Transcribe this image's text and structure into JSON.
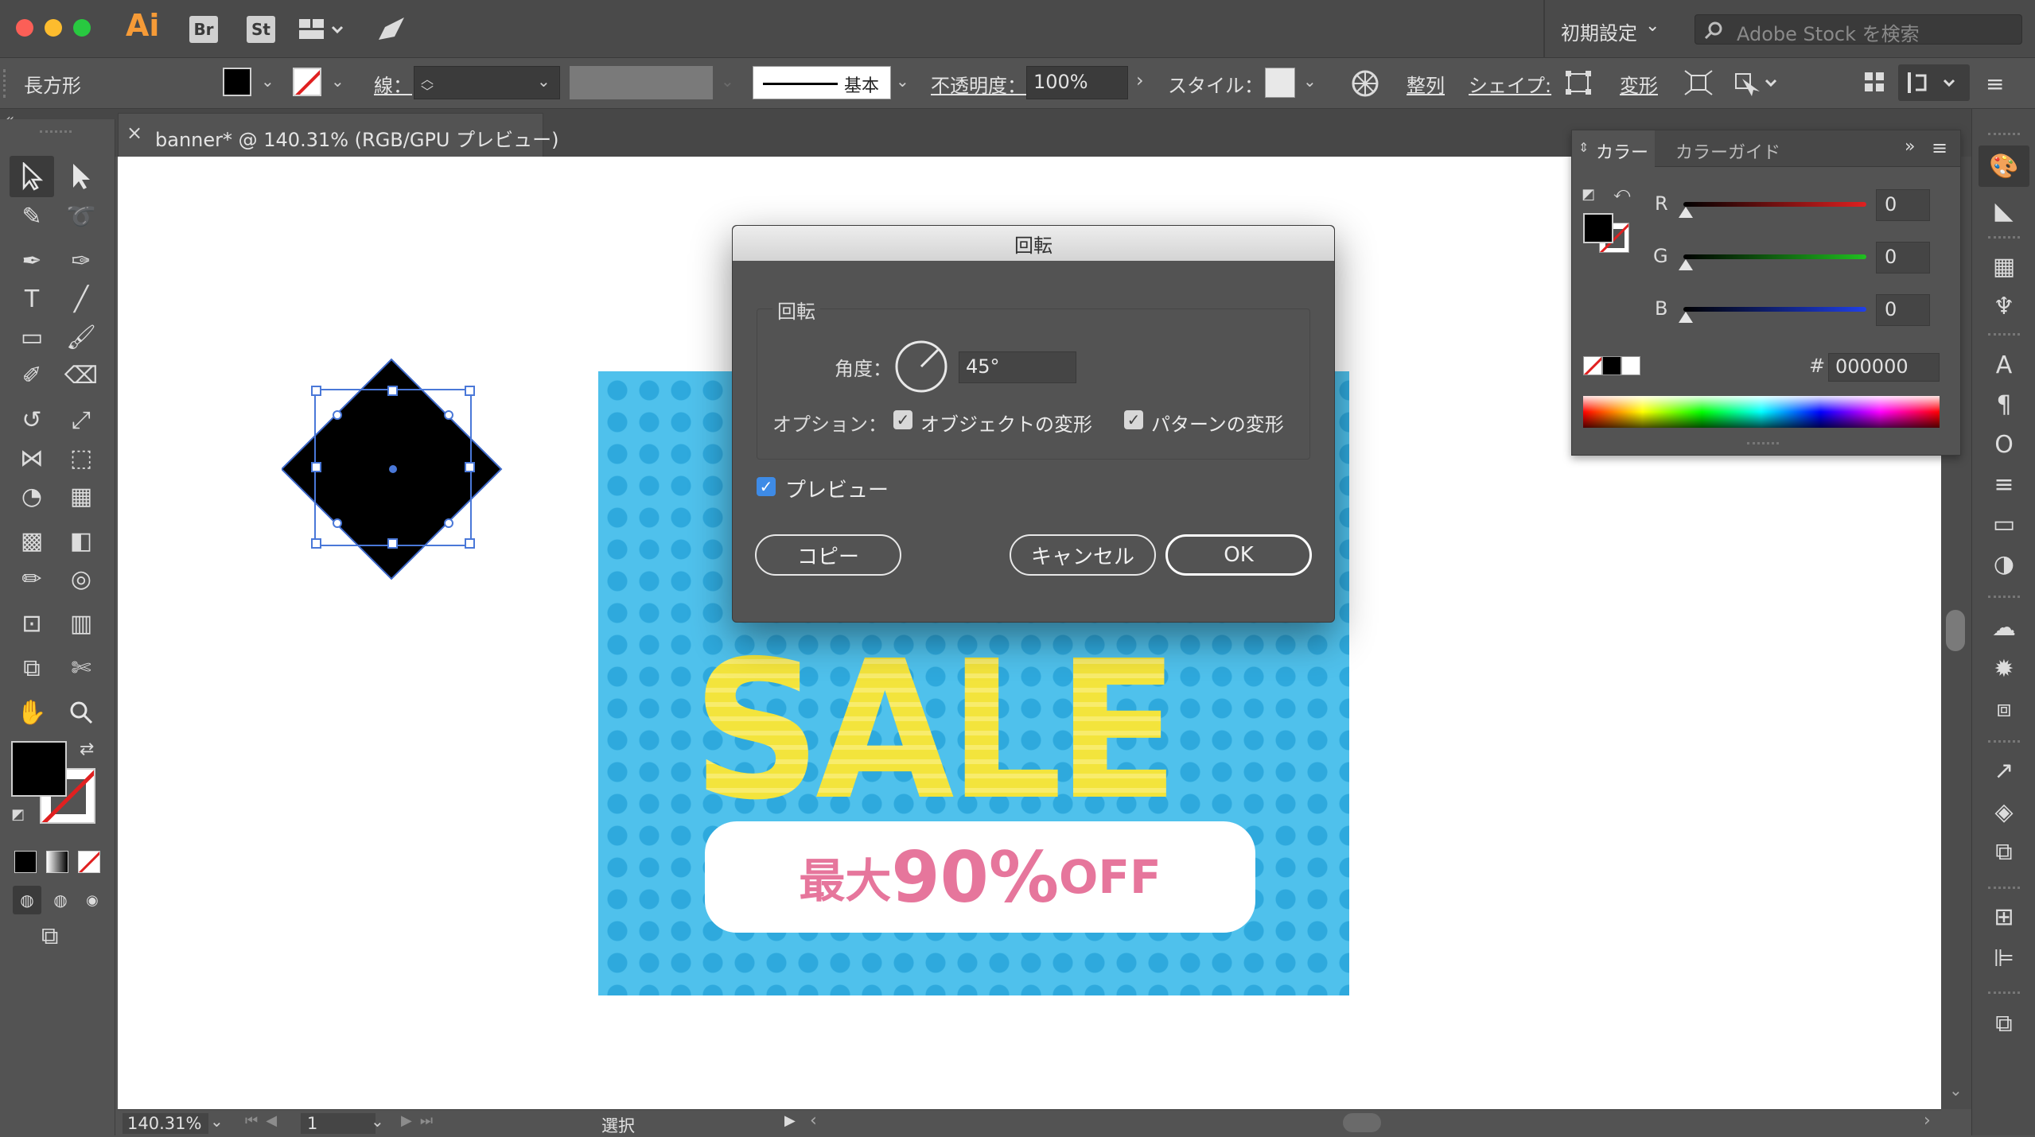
{
  "app": {
    "logo": "Ai",
    "br": "Br",
    "st": "St",
    "workspace": "初期設定",
    "stock_search_placeholder": "Adobe Stock を検索"
  },
  "control_bar": {
    "object_type": "長方形",
    "stroke_label": "線：",
    "brush_label": "基本",
    "opacity_label": "不透明度：",
    "opacity_value": "100%",
    "style_label": "スタイル：",
    "align_label": "整列",
    "shape_label": "シェイプ:",
    "transform_label": "変形"
  },
  "document_tab": {
    "close": "×",
    "title": "banner* @ 140.31% (RGB/GPU プレビュー)"
  },
  "banner": {
    "sale_text": "SALE",
    "offer_prefix": "最大",
    "offer_percent": "90%",
    "offer_suffix": "OFF"
  },
  "rotate_dialog": {
    "title": "回転",
    "group_label": "回転",
    "angle_label": "角度：",
    "angle_value": "45°",
    "options_label": "オプション：",
    "option_objects": "オブジェクトの変形",
    "option_patterns": "パターンの変形",
    "preview_label": "プレビュー",
    "copy_button": "コピー",
    "cancel_button": "キャンセル",
    "ok_button": "OK"
  },
  "color_panel": {
    "tab_color": "カラー",
    "tab_guide": "カラーガイド",
    "r_label": "R",
    "g_label": "G",
    "b_label": "B",
    "r_value": "0",
    "g_value": "0",
    "b_value": "0",
    "hash": "#",
    "hex_value": "000000"
  },
  "status_bar": {
    "zoom": "140.31%",
    "artboard": "1",
    "tool_name": "選択"
  },
  "colors": {
    "banner_blue": "#4fc1ec",
    "banner_dot": "#2ea9dd",
    "sale_yellow": "#f3e43c",
    "offer_pink": "#e6769c"
  }
}
